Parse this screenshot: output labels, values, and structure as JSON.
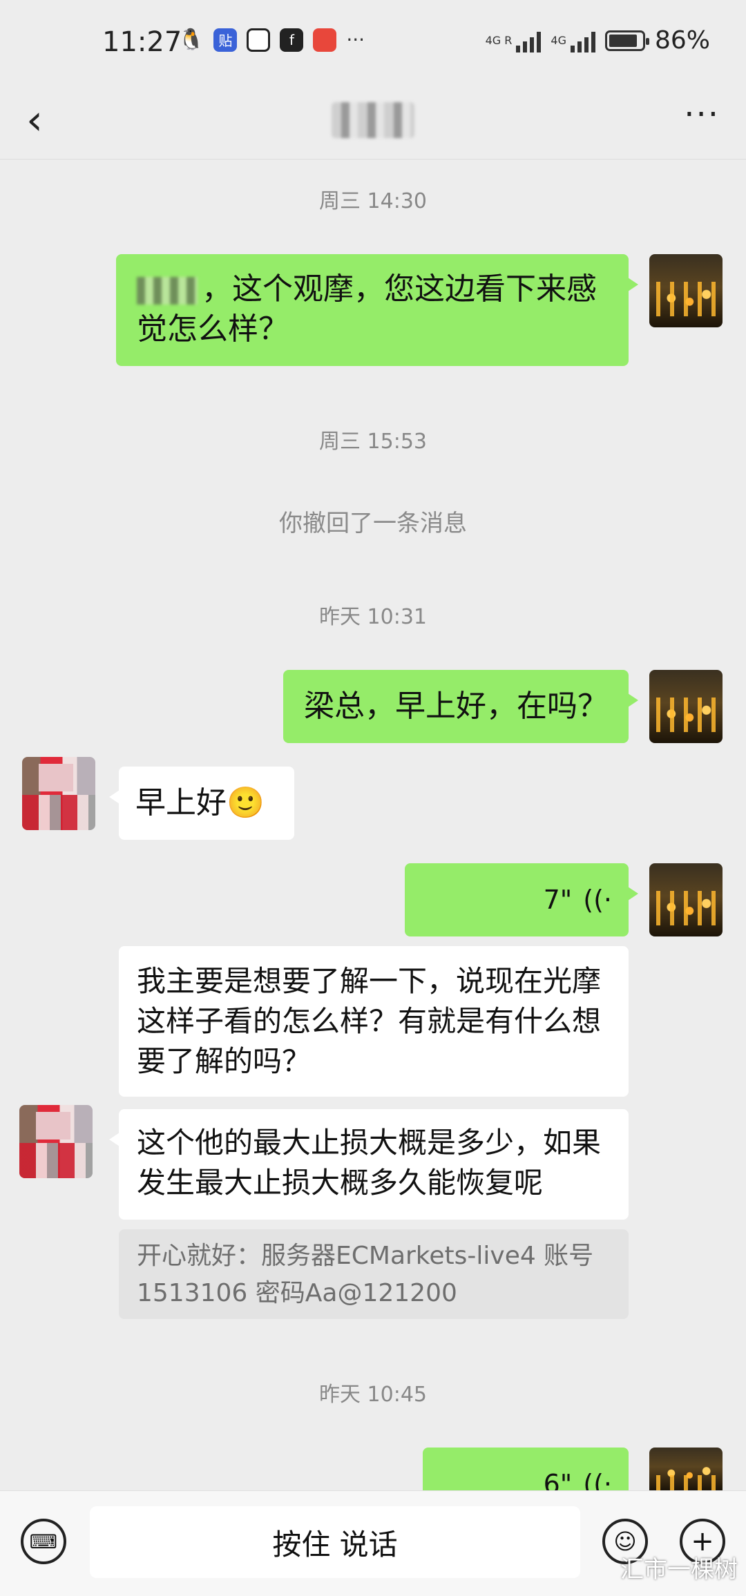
{
  "status": {
    "time": "11:27",
    "net1": "4G R",
    "net2": "4G",
    "battery": "86%",
    "battery_level": 0.86,
    "more": "···"
  },
  "nav": {
    "back": "‹",
    "more": "···"
  },
  "messages": {
    "ts1": "周三 14:30",
    "m1_text": "，这个观摩，您这边看下来感觉怎么样？",
    "ts2": "周三 15:53",
    "recall": "你撤回了一条消息",
    "ts3": "昨天 10:31",
    "m2_text": "梁总，早上好，在吗？",
    "m3_text": "早上好🙂",
    "m4_voice": "7\"",
    "m5_text": "我主要是想要了解一下，说现在光摩这样子看的怎么样？有就是有什么想要了解的吗？",
    "m6_text": "这个他的最大止损大概是多少，如果发生最大止损大概多久能恢复呢",
    "m6_ref": "开心就好：服务器ECMarkets-live4 账号1513106 密码Aa@121200",
    "ts4": "昨天 10:45",
    "m7_voice": "6\""
  },
  "bottom": {
    "talk": "按住 说话",
    "watermark": "汇市一棵树"
  }
}
